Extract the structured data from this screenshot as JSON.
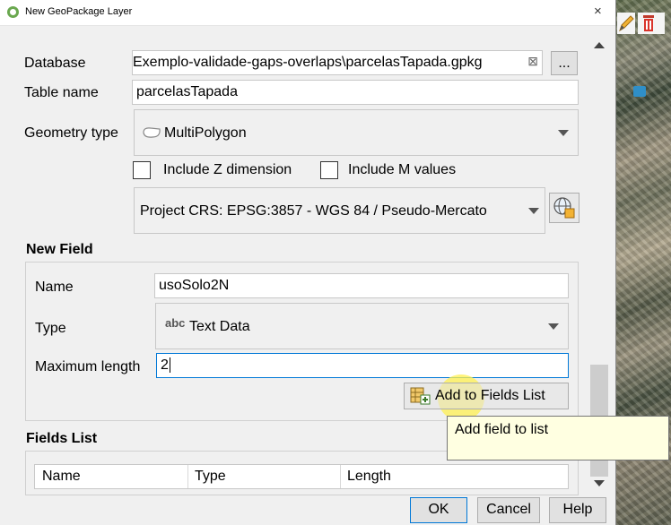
{
  "window": {
    "title": "New GeoPackage Layer",
    "close_glyph": "×"
  },
  "form": {
    "database_label": "Database",
    "database_value": "Exemplo-validade-gaps-overlaps\\parcelasTapada.gpkg",
    "clear_glyph": "⊠",
    "browse_label": "...",
    "table_name_label": "Table name",
    "table_name_value": "parcelasTapada",
    "geometry_type_label": "Geometry type",
    "geometry_type_value": "MultiPolygon",
    "include_z_label": "Include Z dimension",
    "include_m_label": "Include M values",
    "crs_value": "Project CRS: EPSG:3857 - WGS 84 / Pseudo-Mercato"
  },
  "new_field": {
    "section_title": "New Field",
    "name_label": "Name",
    "name_value": "usoSolo2N",
    "type_label": "Type",
    "type_prefix": "abc",
    "type_value": "Text Data",
    "max_length_label": "Maximum length",
    "max_length_value": "2",
    "add_button_label": "Add to Fields List"
  },
  "tooltip": {
    "text": "Add field to list"
  },
  "fields_list": {
    "section_title": "Fields List",
    "columns": [
      "Name",
      "Type",
      "Length"
    ]
  },
  "buttons": {
    "ok": "OK",
    "cancel": "Cancel",
    "help": "Help"
  },
  "icons": [
    "qgis-logo-icon",
    "globe-crs-icon",
    "add-field-icon",
    "polygon-icon",
    "pencil-icon",
    "trash-icon"
  ],
  "colors": {
    "dialog_bg": "#f0f0f0",
    "tooltip_bg": "#ffffe1",
    "highlight": "#fff050",
    "focus_border": "#0078d7"
  }
}
